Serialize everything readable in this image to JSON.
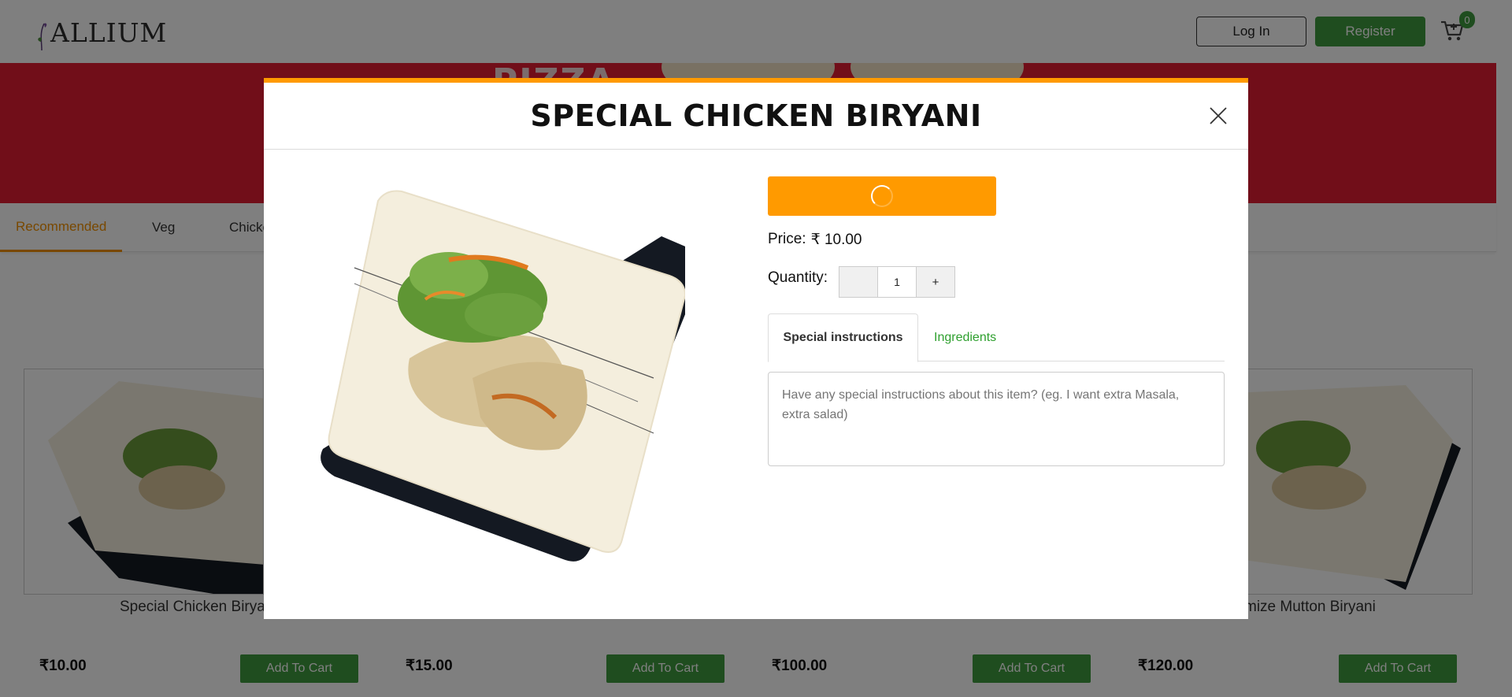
{
  "header": {
    "logo_text": "ALLIUM",
    "login_label": "Log In",
    "register_label": "Register",
    "cart_count": "0"
  },
  "banner": {
    "text": "PIZZA"
  },
  "categories": {
    "items": [
      "Recommended",
      "Veg",
      "Chicke"
    ],
    "active": "Recommended"
  },
  "products": [
    {
      "name": "Special Chicken Birya",
      "price": "₹10.00",
      "button": "Add To Cart"
    },
    {
      "name": "",
      "price": "₹15.00",
      "button": "Add To Cart"
    },
    {
      "name": "",
      "price": "₹100.00",
      "button": "Add To Cart"
    },
    {
      "name": "mize Mutton Biryani",
      "price": "₹120.00",
      "button": "Add To Cart"
    }
  ],
  "modal": {
    "title": "SPECIAL CHICKEN BIRYANI",
    "price_label": "Price:",
    "price_value": "₹ 10.00",
    "quantity_label": "Quantity:",
    "quantity_value": "1",
    "quantity_plus": "+",
    "tabs": [
      "Special instructions",
      "Ingredients"
    ],
    "active_tab": "Special instructions",
    "instructions_placeholder": "Have any special instructions about this item? (eg. I want extra Masala, extra salad)"
  },
  "colors": {
    "accent_orange": "#ff9a00",
    "brand_green": "#3f9a3f",
    "banner_red": "#e31d32",
    "tab_active": "#f29100"
  }
}
